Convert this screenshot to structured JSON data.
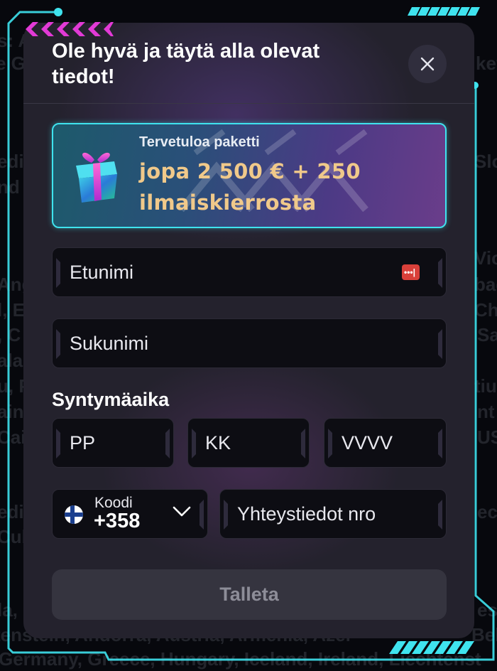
{
  "background_lines": [
    "s: A",
    "e Gu",
    "key",
    "edic",
    "Slo",
    "nd",
    "Vic",
    "Ang",
    "bad",
    "l, E",
    "Chi",
    ", C",
    "Sa",
    "ala",
    "tiu",
    "u, P",
    "ain",
    "nt",
    "Cai",
    "US",
    "edic",
    "Cub",
    "ec",
    "la,",
    "es",
    "tenstein, Andorra, Austria, Armenia, Azer",
    "Bel",
    "Germany, Greece, Hungary, Iceland, Ireland, Liechtenst"
  ],
  "modal": {
    "title": "Ole hyvä ja täytä alla olevat tiedot!",
    "close_icon": "close-icon"
  },
  "banner": {
    "label": "Tervetuloa paketti",
    "offer": "jopa 2 500 € + 250 ilmaiskierrosta",
    "icon": "gift-icon"
  },
  "form": {
    "first_name_placeholder": "Etunimi",
    "last_name_placeholder": "Sukunimi",
    "birthdate_title": "Syntymäaika",
    "day_placeholder": "PP",
    "month_placeholder": "KK",
    "year_placeholder": "VVVV",
    "phone_code_label": "Koodi",
    "phone_code_value": "+358",
    "phone_placeholder": "Yhteystiedot nro",
    "submit_label": "Talleta"
  },
  "colors": {
    "accent_cyan": "#3fe3ee",
    "accent_pink": "#e23ad6",
    "offer_gold": "#f0c98a",
    "modal_bg": "#24222d",
    "field_bg": "#0d0d13"
  }
}
